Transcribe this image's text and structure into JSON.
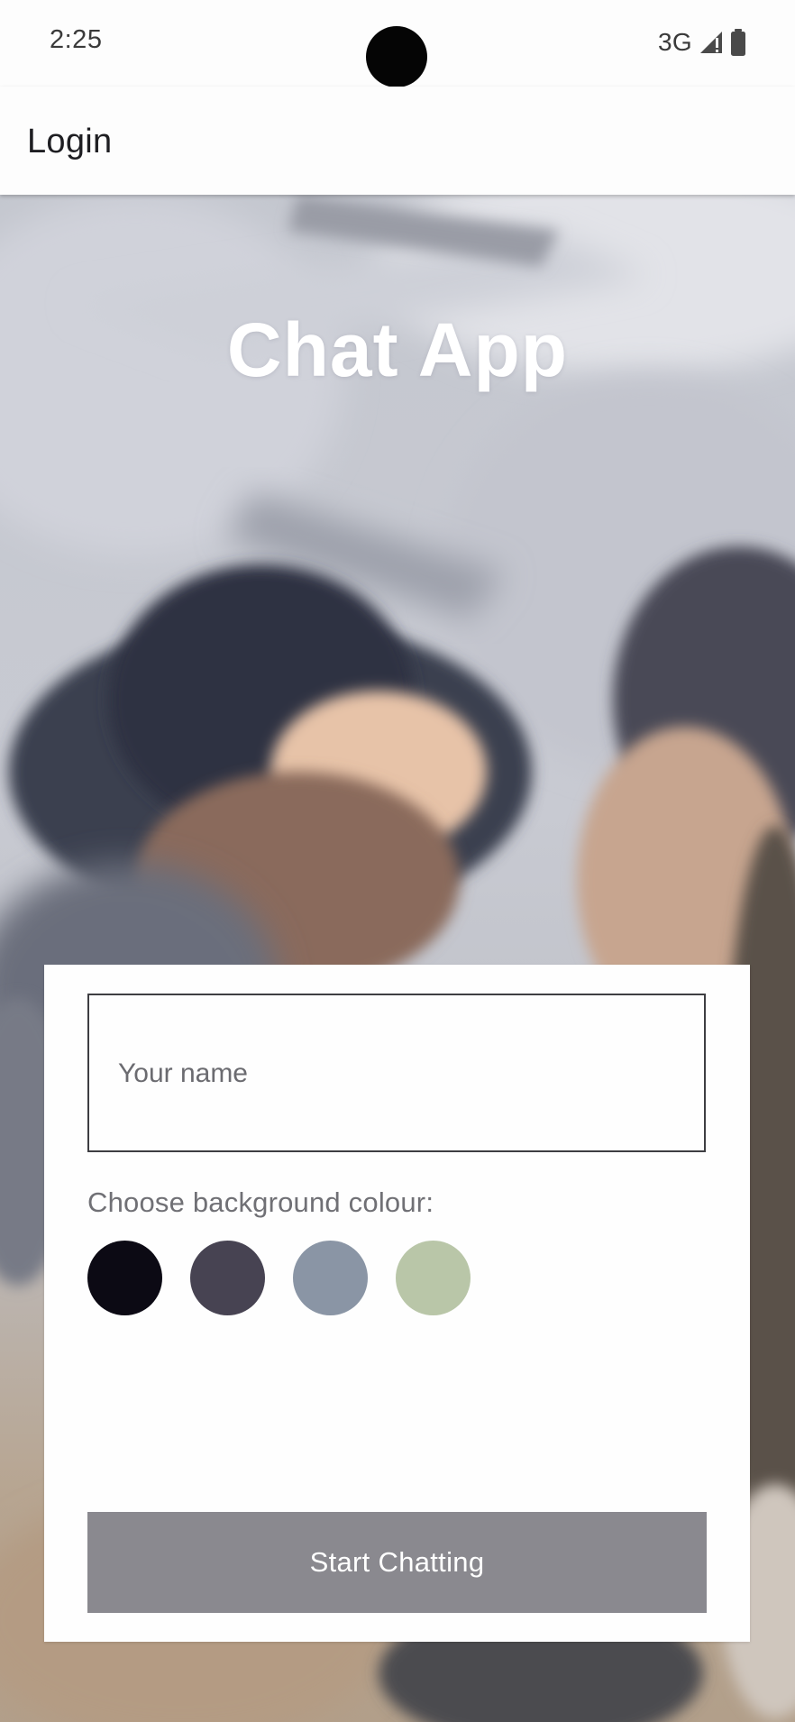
{
  "status_bar": {
    "time": "2:25",
    "network": "3G",
    "signal_icon": "signal-icon",
    "battery_icon": "battery-icon"
  },
  "app_bar": {
    "title": "Login"
  },
  "hero": {
    "title": "Chat App"
  },
  "form": {
    "name_value": "",
    "name_placeholder": "Your name",
    "colour_label": "Choose background colour:",
    "colours": [
      "#0c0a14",
      "#474352",
      "#8a95a5",
      "#b9c6a8"
    ],
    "start_button": "Start Chatting"
  },
  "colors": {
    "button_background": "#8a898f",
    "surface": "#fefefe",
    "title_text": "#ffffff"
  }
}
